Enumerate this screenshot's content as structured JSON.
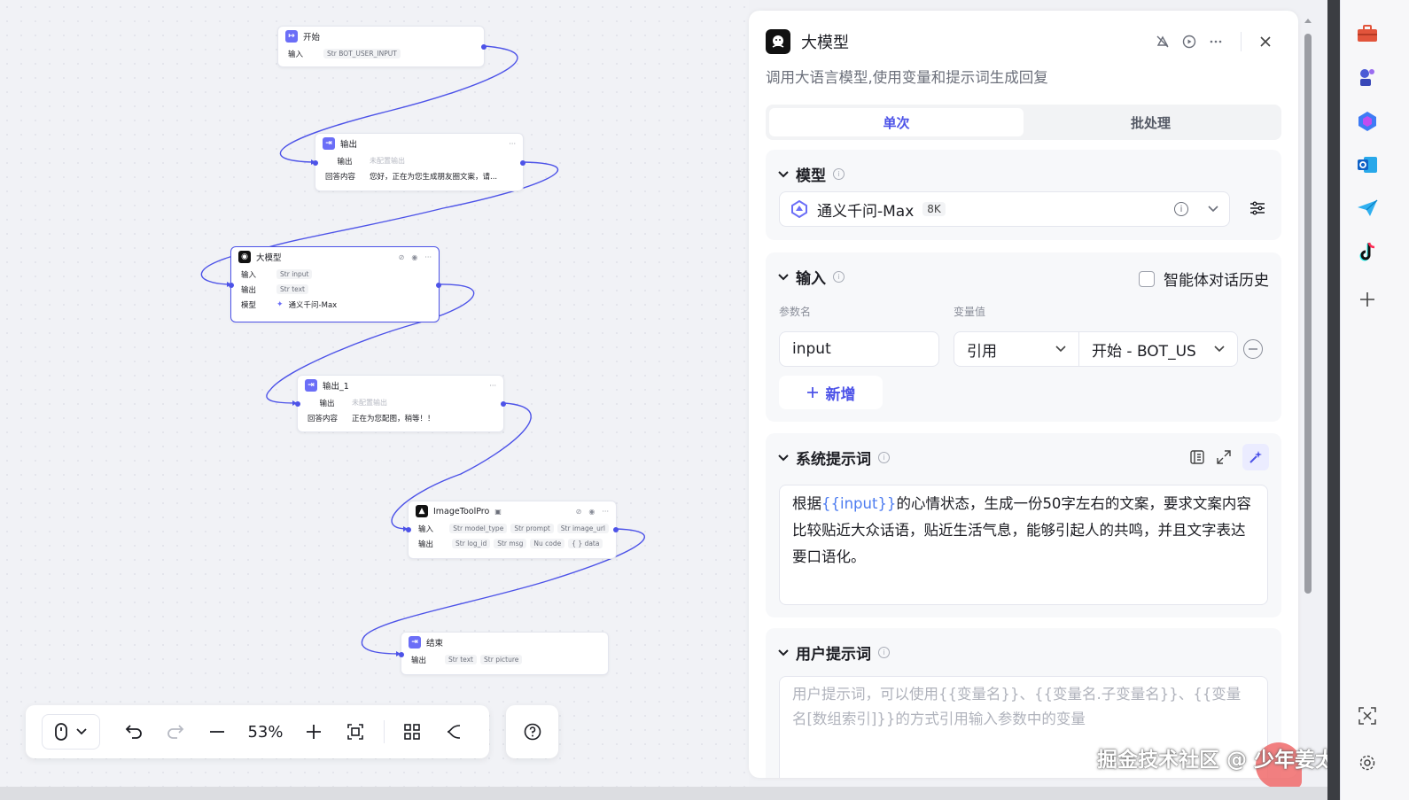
{
  "canvas": {
    "nodes": {
      "start": {
        "title": "开始",
        "row_label": "输入",
        "tag": "BOT_USER_INPUT"
      },
      "output": {
        "title": "输出",
        "rows": [
          {
            "label": "输出",
            "value": "未配置输出"
          },
          {
            "label": "回答内容",
            "value": "您好，正在为您生成朋友圈文案，请..."
          }
        ],
        "more": "···"
      },
      "llm": {
        "title": "大模型",
        "rows": [
          {
            "label": "输入",
            "tags": [
              "input"
            ]
          },
          {
            "label": "输出",
            "tags": [
              "text"
            ]
          },
          {
            "label": "模型",
            "value": "通义千问-Max"
          }
        ]
      },
      "output1": {
        "title": "输出_1",
        "rows": [
          {
            "label": "输出",
            "value": "未配置输出"
          },
          {
            "label": "回答内容",
            "value": "正在为您配图，稍等！！"
          }
        ],
        "more": "···"
      },
      "imagetool": {
        "title": "ImageToolPro",
        "rows": [
          {
            "label": "输入",
            "tags": [
              "model_type",
              "prompt",
              "image_url"
            ]
          },
          {
            "label": "输出",
            "tags": [
              "log_id",
              "msg",
              "code",
              "data"
            ]
          }
        ]
      },
      "end": {
        "title": "结束",
        "rows": [
          {
            "label": "输出",
            "tags": [
              "text",
              "picture"
            ]
          }
        ]
      }
    },
    "tag_prefix": "Str",
    "tag_prefix_num": "Nu",
    "tag_prefix_obj": "{ }"
  },
  "toolbar": {
    "zoom": "53%"
  },
  "panel": {
    "title": "大模型",
    "description": "调用大语言模型,使用变量和提示词生成回复",
    "tabs": [
      "单次",
      "批处理"
    ],
    "model_section": {
      "title": "模型",
      "model_name": "通义千问-Max",
      "badge": "8K"
    },
    "input_section": {
      "title": "输入",
      "history_label": "智能体对话历史",
      "col_param": "参数名",
      "col_value": "变量值",
      "param_name": "input",
      "ref_type": "引用",
      "ref_value": "开始 - BOT_US",
      "add_label": "新增"
    },
    "system_prompt": {
      "title": "系统提示词",
      "text_before": "根据",
      "variable": "{{input}}",
      "text_after": "的心情状态，生成一份50字左右的文案，要求文案内容比较贴近大众话语，贴近生活气息，能够引起人的共鸣，并且文字表达要口语化。"
    },
    "user_prompt": {
      "title": "用户提示词",
      "placeholder": "用户提示词，可以使用{{变量名}}、{{变量名.子变量名}}、{{变量名[数组索引]}}的方式引用输入参数中的变量"
    }
  },
  "watermark": "掘金技术社区 @ 少年姜太公"
}
